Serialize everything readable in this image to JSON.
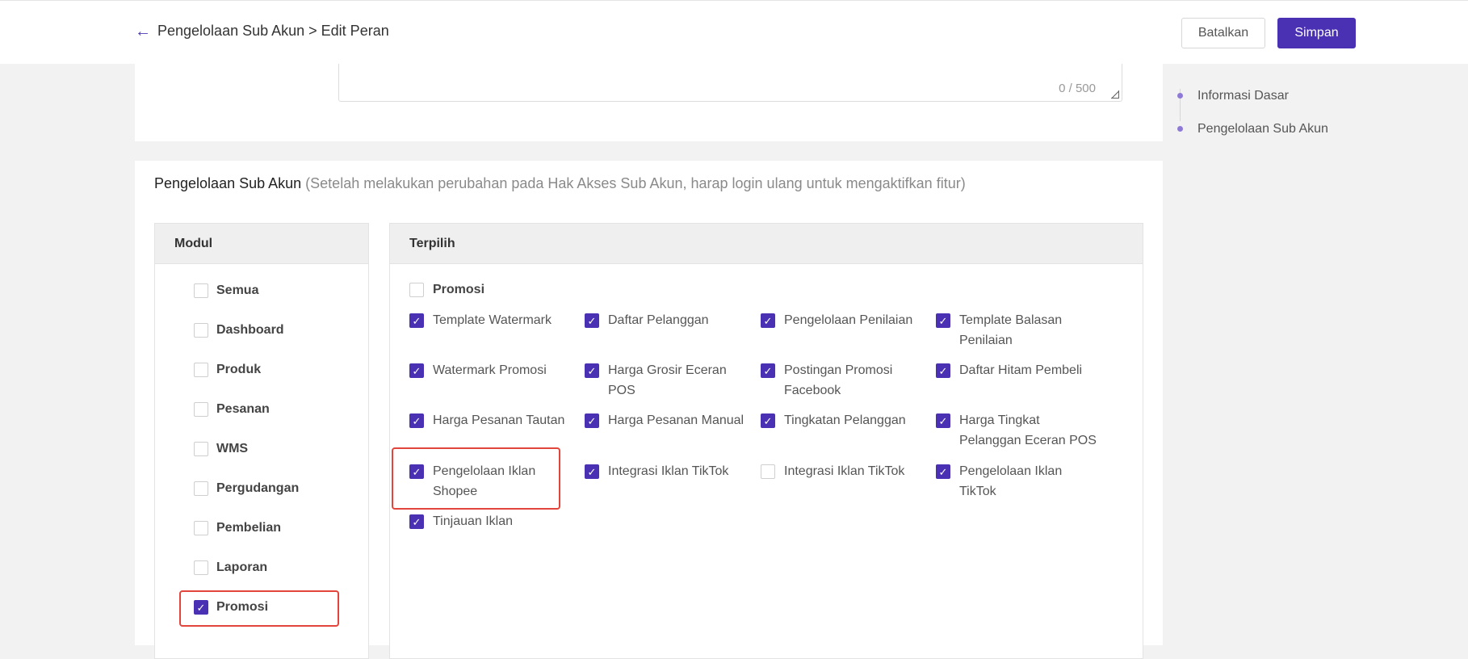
{
  "header": {
    "breadcrumb": "Pengelolaan Sub Akun > Edit Peran",
    "cancel_label": "Batalkan",
    "save_label": "Simpan"
  },
  "description": {
    "counter": "0 / 500"
  },
  "side_nav": {
    "items": [
      {
        "label": "Informasi Dasar"
      },
      {
        "label": "Pengelolaan Sub Akun"
      }
    ]
  },
  "section": {
    "title": "Pengelolaan Sub Akun",
    "note": "(Setelah melakukan perubahan pada Hak Akses Sub Akun, harap login ulang untuk mengaktifkan fitur)"
  },
  "modules": {
    "header": "Modul",
    "items": [
      {
        "label": "Semua",
        "checked": false
      },
      {
        "label": "Dashboard",
        "checked": false
      },
      {
        "label": "Produk",
        "checked": false
      },
      {
        "label": "Pesanan",
        "checked": false
      },
      {
        "label": "WMS",
        "checked": false
      },
      {
        "label": "Pergudangan",
        "checked": false
      },
      {
        "label": "Pembelian",
        "checked": false
      },
      {
        "label": "Laporan",
        "checked": false
      },
      {
        "label": "Promosi",
        "checked": true
      }
    ]
  },
  "selected": {
    "header": "Terpilih",
    "group_label": "Promosi",
    "group_checked": false,
    "items": [
      {
        "label": "Template Watermark",
        "checked": true
      },
      {
        "label": "Daftar Pelanggan",
        "checked": true
      },
      {
        "label": "Pengelolaan Penilaian",
        "checked": true
      },
      {
        "label": "Template Balasan Penilaian",
        "checked": true
      },
      {
        "label": "Watermark Promosi",
        "checked": true
      },
      {
        "label": "Harga Grosir Eceran POS",
        "checked": true
      },
      {
        "label": "Postingan Promosi Facebook",
        "checked": true
      },
      {
        "label": "Daftar Hitam Pembeli",
        "checked": true
      },
      {
        "label": "Harga Pesanan Tautan",
        "checked": true
      },
      {
        "label": "Harga Pesanan Manual",
        "checked": true
      },
      {
        "label": "Tingkatan Pelanggan",
        "checked": true
      },
      {
        "label": "Harga Tingkat Pelanggan Eceran POS",
        "checked": true
      },
      {
        "label": "Pengelolaan Iklan Shopee",
        "checked": true
      },
      {
        "label": "Integrasi Iklan TikTok",
        "checked": true
      },
      {
        "label": "Integrasi Iklan TikTok",
        "checked": false
      },
      {
        "label": "Pengelolaan Iklan TikTok",
        "checked": true
      },
      {
        "label": "Tinjauan Iklan",
        "checked": true
      }
    ]
  },
  "colors": {
    "accent": "#4a31b3",
    "highlight": "#e2453c"
  }
}
